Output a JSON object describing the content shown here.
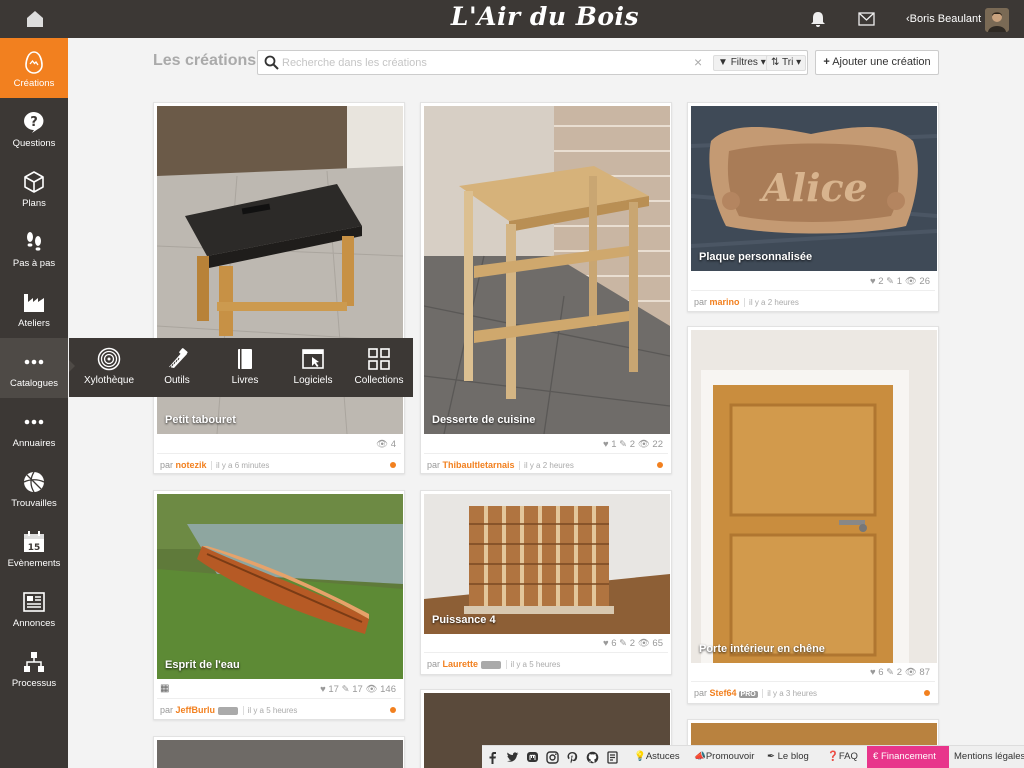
{
  "app": {
    "title": "L'Air du Bois",
    "user_name": "Boris Beaulant",
    "accent": "#f2801f",
    "bar_color": "#3c3835"
  },
  "sidebar": {
    "items": [
      {
        "label": "Créations",
        "icon": "egg-icon",
        "active": true
      },
      {
        "label": "Questions",
        "icon": "question-icon"
      },
      {
        "label": "Plans",
        "icon": "cube-icon"
      },
      {
        "label": "Pas à pas",
        "icon": "footsteps-icon"
      },
      {
        "label": "Ateliers",
        "icon": "factory-icon"
      },
      {
        "label": "Catalogues",
        "icon": "dots-icon"
      },
      {
        "label": "Annuaires",
        "icon": "dots-icon"
      },
      {
        "label": "Trouvailles",
        "icon": "ball-icon"
      },
      {
        "label": "Evènements",
        "icon": "calendar-icon"
      },
      {
        "label": "Annonces",
        "icon": "newspaper-icon"
      },
      {
        "label": "Processus",
        "icon": "flow-icon"
      }
    ]
  },
  "calendar_day": "15",
  "flyout": {
    "items": [
      {
        "label": "Xylothèque",
        "icon": "wood-rings-icon"
      },
      {
        "label": "Outils",
        "icon": "saw-icon"
      },
      {
        "label": "Livres",
        "icon": "book-icon"
      },
      {
        "label": "Logiciels",
        "icon": "software-window-icon"
      },
      {
        "label": "Collections",
        "icon": "grid-icon"
      }
    ]
  },
  "header": {
    "title": "Les créations",
    "search_placeholder": "Recherche dans les créations",
    "search_value": "",
    "filters_label": "Filtres",
    "sort_label": "Tri",
    "add_label": "Ajouter une création"
  },
  "cards": [
    {
      "title": "Petit tabouret",
      "likes": "",
      "comments": "",
      "views": "4",
      "author": "notezik",
      "ago": "il y a 6 minutes",
      "badge": "",
      "dot": true
    },
    {
      "title": "Desserte de cuisine",
      "likes": "1",
      "comments": "2",
      "views": "22",
      "author": "Thibaultletarnais",
      "ago": "il y a 2 heures",
      "badge": "",
      "dot": true
    },
    {
      "title": "Plaque personnalisée",
      "likes": "2",
      "comments": "1",
      "views": "26",
      "author": "marino",
      "ago": "il y a 2 heures",
      "badge": "",
      "dot": false
    },
    {
      "title": "Esprit de l'eau",
      "likes": "17",
      "comments": "17",
      "views": "146",
      "author": "JeffBurlu",
      "ago": "il y a 5 heures",
      "badge": "",
      "dot": true
    },
    {
      "title": "Puissance 4",
      "likes": "6",
      "comments": "2",
      "views": "65",
      "author": "Laurette",
      "ago": "il y a 5 heures",
      "badge": "",
      "dot": false
    },
    {
      "title": "Porte intérieur en chêne",
      "likes": "6",
      "comments": "2",
      "views": "87",
      "author": "Stef64",
      "ago": "il y a 3 heures",
      "badge": "PRO",
      "dot": true
    }
  ],
  "footer": {
    "social": [
      "facebook-icon",
      "twitter-icon",
      "mastodon-icon",
      "instagram-icon",
      "pinterest-icon",
      "github-icon",
      "blog-feed-icon"
    ],
    "links": [
      "Astuces",
      "Promouvoir",
      "Le blog",
      "FAQ",
      "Financement",
      "Mentions légales"
    ]
  }
}
